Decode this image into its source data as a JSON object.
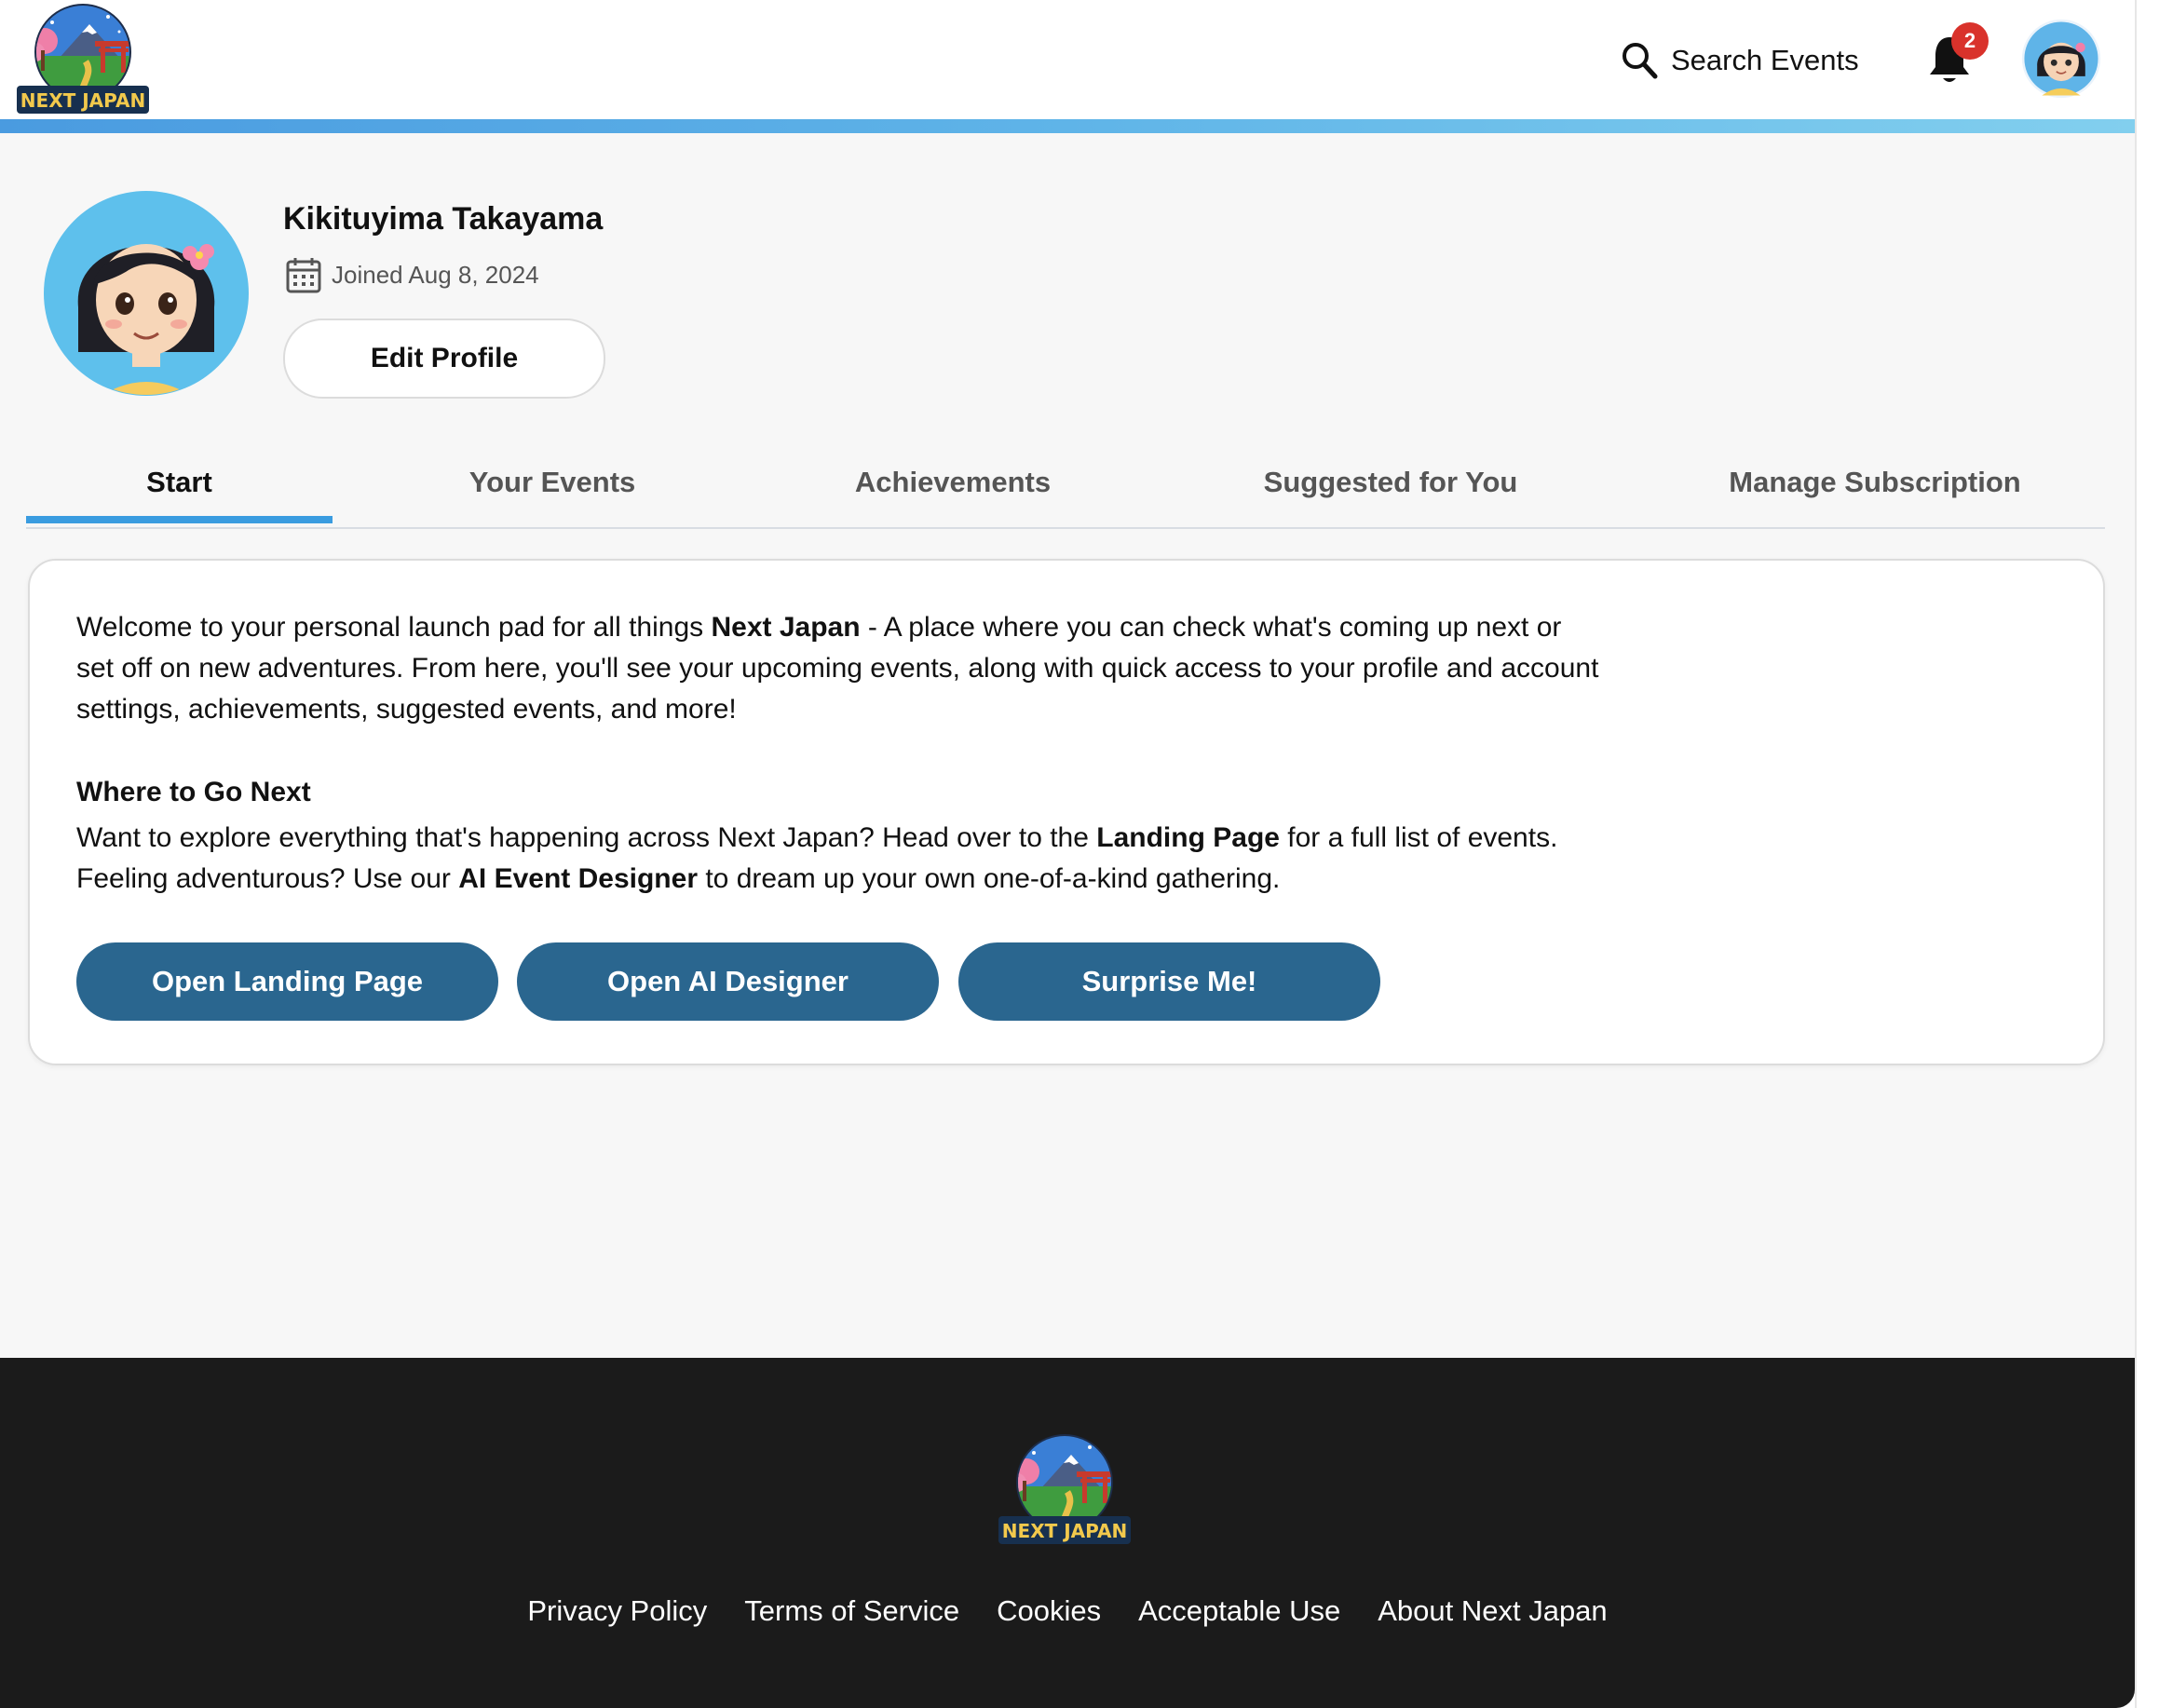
{
  "brand": {
    "logo_text": "NEXT JAPAN"
  },
  "header": {
    "search_label": "Search Events",
    "notification_count": "2"
  },
  "profile": {
    "name": "Kikituyima Takayama",
    "joined": "Joined Aug 8, 2024",
    "edit_label": "Edit Profile"
  },
  "tabs": [
    {
      "label": "Start",
      "active": true
    },
    {
      "label": "Your Events"
    },
    {
      "label": "Achievements"
    },
    {
      "label": "Suggested for You"
    },
    {
      "label": "Manage Subscription"
    }
  ],
  "start": {
    "intro_part1": "Welcome to your personal launch pad for all things ",
    "intro_bold": "Next Japan",
    "intro_part2": " - A place where you can check what's coming up next or set off on new adventures. From here, you'll see your upcoming events, along with quick access to your profile and account settings, achievements, suggested events, and more!",
    "where_heading": "Where to Go Next",
    "where_part1": "Want to explore everything that's happening across Next Japan? Head over to the ",
    "where_bold1": "Landing Page",
    "where_part2": " for a full list of events. Feeling adventurous? Use our ",
    "where_bold2": "AI Event Designer",
    "where_part3": " to dream up your own one-of-a-kind gathering.",
    "buttons": [
      "Open Landing Page",
      "Open AI Designer",
      "Surprise Me!"
    ]
  },
  "footer": {
    "links": [
      "Privacy Policy",
      "Terms of Service",
      "Cookies",
      "Acceptable Use",
      "About Next Japan"
    ]
  },
  "colors": {
    "accent": "#3a9ce0",
    "button": "#2a668f",
    "badge": "#d9322b",
    "footer_bg": "#1b1b1b"
  },
  "icons": [
    "search-icon",
    "bell-icon",
    "calendar-icon"
  ]
}
